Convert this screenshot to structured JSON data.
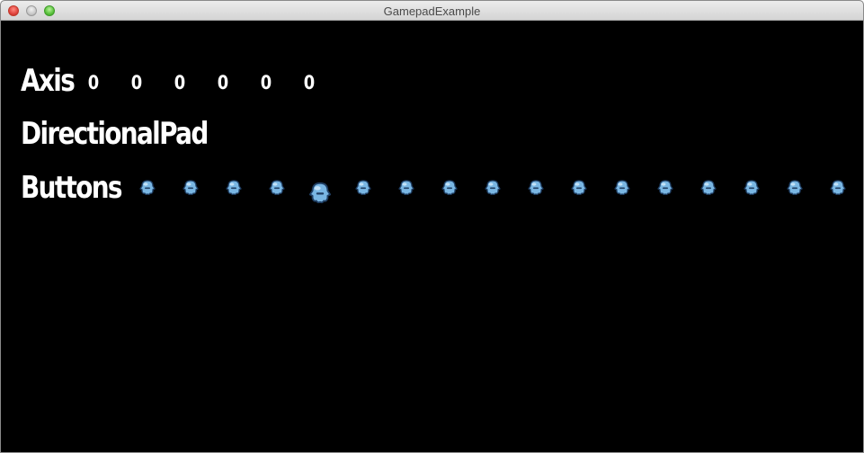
{
  "window": {
    "title": "GamepadExample"
  },
  "labels": {
    "axis": "Axis",
    "directional_pad": "DirectionalPad",
    "buttons": "Buttons"
  },
  "axis_values": [
    "0",
    "0",
    "0",
    "0",
    "0",
    "0"
  ],
  "buttons": [
    {
      "pressed": false
    },
    {
      "pressed": false
    },
    {
      "pressed": false
    },
    {
      "pressed": false
    },
    {
      "pressed": true
    },
    {
      "pressed": false
    },
    {
      "pressed": false
    },
    {
      "pressed": false
    },
    {
      "pressed": false
    },
    {
      "pressed": false
    },
    {
      "pressed": false
    },
    {
      "pressed": false
    },
    {
      "pressed": false
    },
    {
      "pressed": false
    },
    {
      "pressed": false
    },
    {
      "pressed": false
    },
    {
      "pressed": false
    }
  ],
  "colors": {
    "blob_fill": "#79b6e3",
    "blob_outline": "#1f3e63",
    "background": "#000000",
    "text": "#ffffff"
  }
}
